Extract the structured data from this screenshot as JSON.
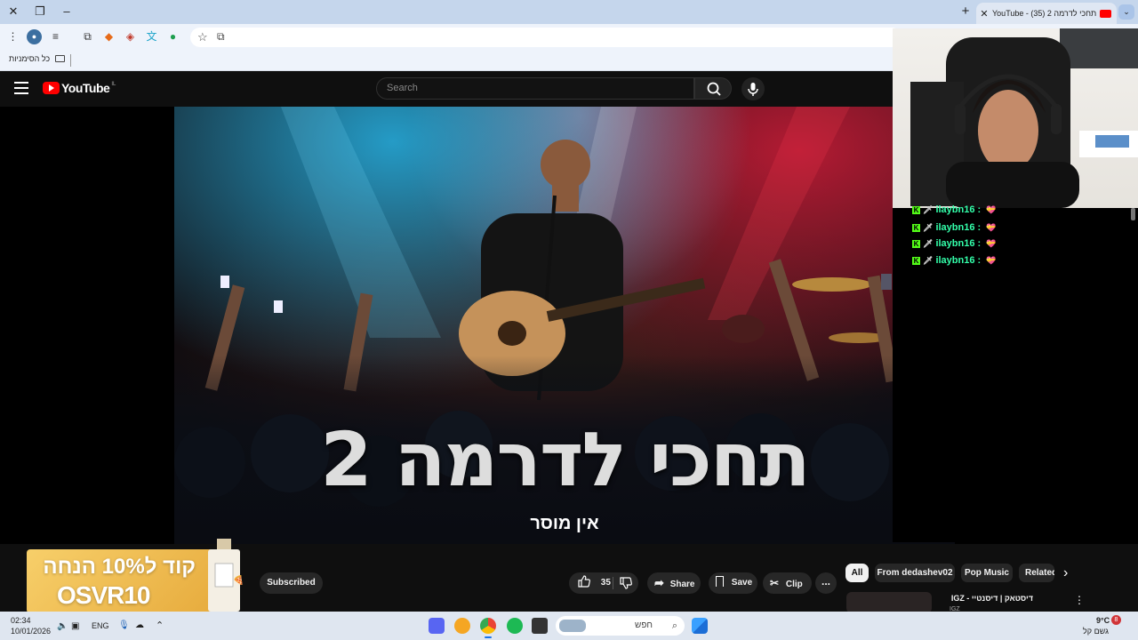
{
  "browser": {
    "tab_title": "YouTube - (35) תחכי לדרמה 2",
    "bookmarks_label": "כל הסימניות"
  },
  "youtube": {
    "logo": "YouTube",
    "country_code": "IL",
    "search_placeholder": "Search"
  },
  "video": {
    "title_overlay": "תחכי לדרמה 2",
    "subtitle_overlay": "אין מוסר"
  },
  "chat": {
    "rows": [
      {
        "user": "ilaybn16 :"
      },
      {
        "user": "ilaybn16 :"
      },
      {
        "user": "ilaybn16 :"
      },
      {
        "user": "ilaybn16 :"
      }
    ]
  },
  "actions": {
    "subscribed_label": "Subscribed",
    "likes": "35",
    "share_label": "Share",
    "save_label": "Save",
    "clip_label": "Clip",
    "more_label": "..."
  },
  "chips": {
    "all": "All",
    "from_channel": "From dedashev02",
    "pop_music": "Pop Music",
    "related": "Related"
  },
  "related_video": {
    "title": "IGZ - דיסטאק | דיסנטיי",
    "channel": "IGZ"
  },
  "ad": {
    "line1": "קוד ל10% הנחה",
    "line2": "OSVR10"
  },
  "taskbar": {
    "time": "02:34",
    "date": "10/01/2026",
    "lang": "ENG",
    "search_label": "חפש",
    "weather_temp": "9°C",
    "weather_desc": "גשם קל",
    "notif_count": "8"
  },
  "colors": {
    "youtube_red": "#ff0000",
    "kick_green": "#53fc18",
    "chat_name": "#33ffaa"
  }
}
